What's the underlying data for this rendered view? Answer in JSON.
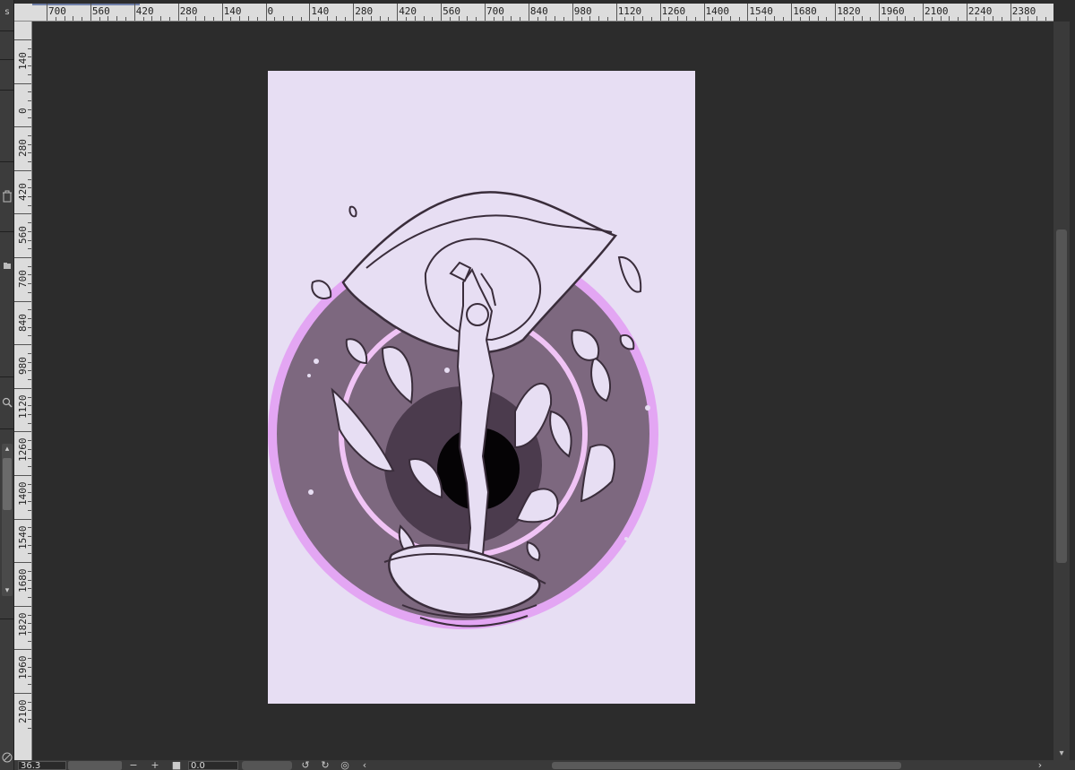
{
  "app": {
    "left_tab_label": "s",
    "icons": {
      "trash": "trash-icon",
      "folder": "folder-icon",
      "zoom": "zoom-icon",
      "nav": "navigator-icon"
    }
  },
  "ruler_top": {
    "labels": [
      "700",
      "560",
      "420",
      "280",
      "140",
      "0",
      "140",
      "280",
      "420",
      "560",
      "700",
      "840",
      "980",
      "1120",
      "1260",
      "1400",
      "1540",
      "1680",
      "1820",
      "1960",
      "2100",
      "2240",
      "2380"
    ]
  },
  "ruler_left": {
    "labels": [
      "140",
      "0",
      "280",
      "420",
      "560",
      "700",
      "840",
      "980",
      "1120",
      "1260",
      "1400",
      "1540",
      "1680",
      "1820",
      "1960",
      "2100"
    ]
  },
  "statusbar": {
    "zoom_value": "36.3",
    "zoom_out": "−",
    "zoom_in": "+",
    "angle_value": "0.0"
  },
  "colors": {
    "paper": "#e7def3",
    "ring_outer": "#e3a6f3",
    "dark_disc": "#7d687f",
    "inner_ring": "#f0c3f5",
    "core_dark": "#4b3b4d",
    "black_hole": "#050305",
    "line_art": "#3a2d3b"
  }
}
